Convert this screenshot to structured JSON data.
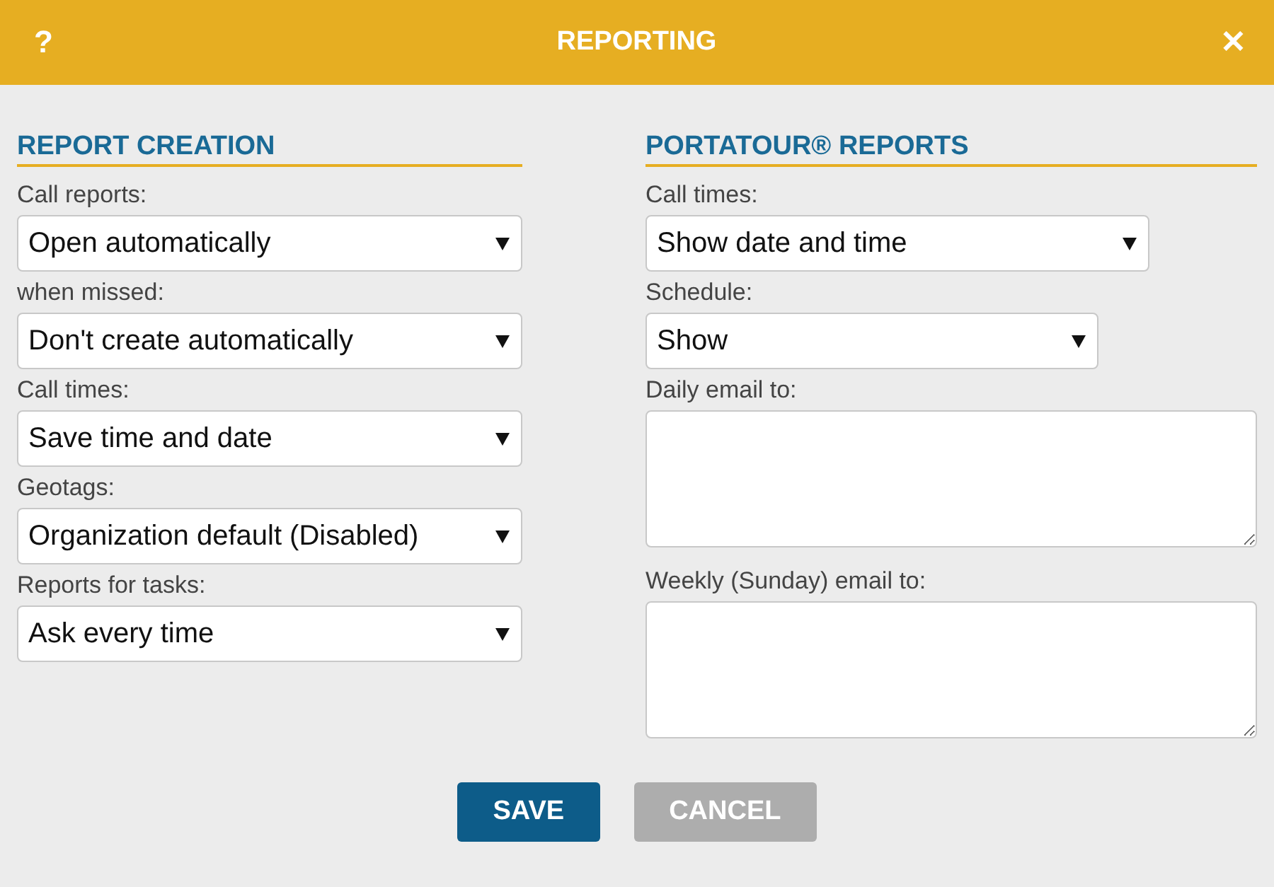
{
  "window": {
    "title": "REPORTING",
    "help_button": "?",
    "close_button": "✕"
  },
  "left_section": {
    "heading": "REPORT CREATION",
    "fields": [
      {
        "kind": "select",
        "label": "Call reports:",
        "value": "Open automatically"
      },
      {
        "kind": "select",
        "label": "when missed:",
        "value": "Don't create automatically"
      },
      {
        "kind": "select",
        "label": "Call times:",
        "value": "Save time and date"
      },
      {
        "kind": "select",
        "label": "Geotags:",
        "value": "Organization default (Disabled)"
      },
      {
        "kind": "select",
        "label": "Reports for tasks:",
        "value": "Ask every time"
      }
    ]
  },
  "right_section": {
    "heading": "PORTATOUR® REPORTS",
    "fields": [
      {
        "kind": "select",
        "label": "Call times:",
        "value": "Show date and time"
      },
      {
        "kind": "select",
        "label": "Schedule:",
        "value": "Show"
      },
      {
        "kind": "textarea",
        "label": "Daily email to:"
      },
      {
        "kind": "textarea",
        "label": "Weekly (Sunday) email to:"
      }
    ]
  },
  "buttons": [
    {
      "label": "SAVE",
      "kind": "primary"
    },
    {
      "label": "CANCEL",
      "kind": "secondary"
    }
  ]
}
